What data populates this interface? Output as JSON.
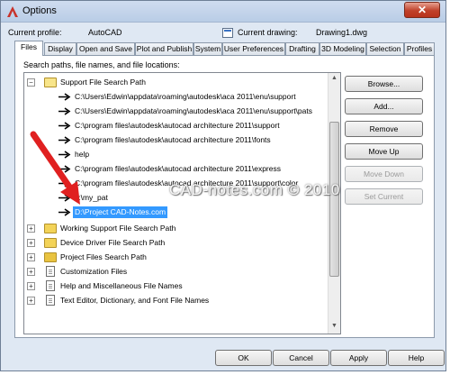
{
  "window": {
    "title": "Options",
    "close_label": "✕"
  },
  "profile": {
    "label": "Current profile:",
    "value": "AutoCAD",
    "drawing_label": "Current drawing:",
    "drawing_value": "Drawing1.dwg"
  },
  "tabs": [
    {
      "label": "Files"
    },
    {
      "label": "Display"
    },
    {
      "label": "Open and Save"
    },
    {
      "label": "Plot and Publish"
    },
    {
      "label": "System"
    },
    {
      "label": "User Preferences"
    },
    {
      "label": "Drafting"
    },
    {
      "label": "3D Modeling"
    },
    {
      "label": "Selection"
    },
    {
      "label": "Profiles"
    }
  ],
  "files_tab": {
    "search_label": "Search paths, file names, and file locations:",
    "tree": {
      "support_root": "Support File Search Path",
      "support_children": [
        "C:\\Users\\Edwin\\appdata\\roaming\\autodesk\\aca 2011\\enu\\support",
        "C:\\Users\\Edwin\\appdata\\roaming\\autodesk\\aca 2011\\enu\\support\\pats",
        "C:\\program files\\autodesk\\autocad architecture 2011\\support",
        "C:\\program files\\autodesk\\autocad architecture 2011\\fonts",
        "help",
        "C:\\program files\\autodesk\\autocad architecture 2011\\express",
        "C:\\program files\\autodesk\\autocad architecture 2011\\support\\color",
        "c:\\my_pat",
        "D:\\Project CAD-Notes.com"
      ],
      "roots": [
        "Working Support File Search Path",
        "Device Driver File Search Path",
        "Project Files Search Path",
        "Customization Files",
        "Help and Miscellaneous File Names",
        "Text Editor, Dictionary, and Font File Names"
      ]
    },
    "buttons": {
      "browse": "Browse...",
      "add": "Add...",
      "remove": "Remove",
      "move_up": "Move Up",
      "move_down": "Move Down",
      "set_current": "Set Current"
    }
  },
  "footer": {
    "ok": "OK",
    "cancel": "Cancel",
    "apply": "Apply",
    "help": "Help"
  },
  "watermark": "CAD-notes.com © 2010",
  "colors": {
    "selection": "#3399ff",
    "annotation_arrow": "#e02020",
    "close_button": "#c0412a"
  }
}
